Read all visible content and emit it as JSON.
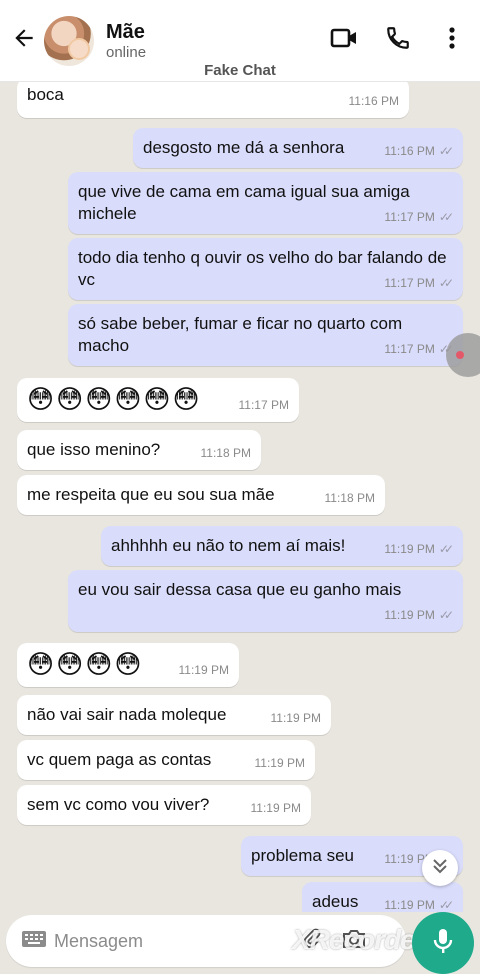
{
  "header": {
    "contact_name": "Mãe",
    "contact_status": "online",
    "overlay_label": "Fake Chat"
  },
  "icons": {
    "back": "arrow-left-icon",
    "video": "video-call-icon",
    "call": "phone-icon",
    "menu": "more-vert-icon",
    "keyboard": "keyboard-icon",
    "attach": "paperclip-icon",
    "camera": "camera-icon",
    "scroll": "chevrons-down-icon",
    "send": "microphone-icon"
  },
  "colors": {
    "incoming": "#ffffff",
    "outgoing": "#d9dcfb",
    "accent": "#1faa8c",
    "background": "#e9e6e0"
  },
  "messages": [
    {
      "dir": "in",
      "text": "boca",
      "time": "11:16 PM"
    },
    {
      "dir": "out",
      "text": "desgosto me dá a senhora",
      "time": "11:16 PM"
    },
    {
      "dir": "out",
      "text": "que vive de cama em cama igual sua amiga michele",
      "time": "11:17 PM"
    },
    {
      "dir": "out",
      "text": "todo dia tenho q ouvir os velho do bar falando de vc",
      "time": "11:17 PM"
    },
    {
      "dir": "out",
      "text": "só sabe beber, fumar e ficar no quarto com macho",
      "time": "11:17 PM"
    },
    {
      "dir": "in",
      "text": "😳😳😳😳😳😳",
      "time": "11:17 PM"
    },
    {
      "dir": "in",
      "text": "que isso menino?",
      "time": "11:18 PM"
    },
    {
      "dir": "in",
      "text": "me respeita que eu sou sua mãe",
      "time": "11:18 PM"
    },
    {
      "dir": "out",
      "text": "ahhhhh eu não to nem aí mais!",
      "time": "11:19 PM"
    },
    {
      "dir": "out",
      "text": "eu vou sair dessa casa que eu ganho mais",
      "time": "11:19 PM"
    },
    {
      "dir": "in",
      "text": "😳😳😳😳",
      "time": "11:19 PM"
    },
    {
      "dir": "in",
      "text": "não vai sair nada moleque",
      "time": "11:19 PM"
    },
    {
      "dir": "in",
      "text": "vc quem paga as contas",
      "time": "11:19 PM"
    },
    {
      "dir": "in",
      "text": "sem vc como vou viver?",
      "time": "11:19 PM"
    },
    {
      "dir": "out",
      "text": "problema seu",
      "time": "11:19 PM"
    },
    {
      "dir": "out",
      "text": "adeus",
      "time": "11:19 PM"
    }
  ],
  "composer": {
    "placeholder": "Mensagem",
    "watermark": "XRecorder"
  }
}
